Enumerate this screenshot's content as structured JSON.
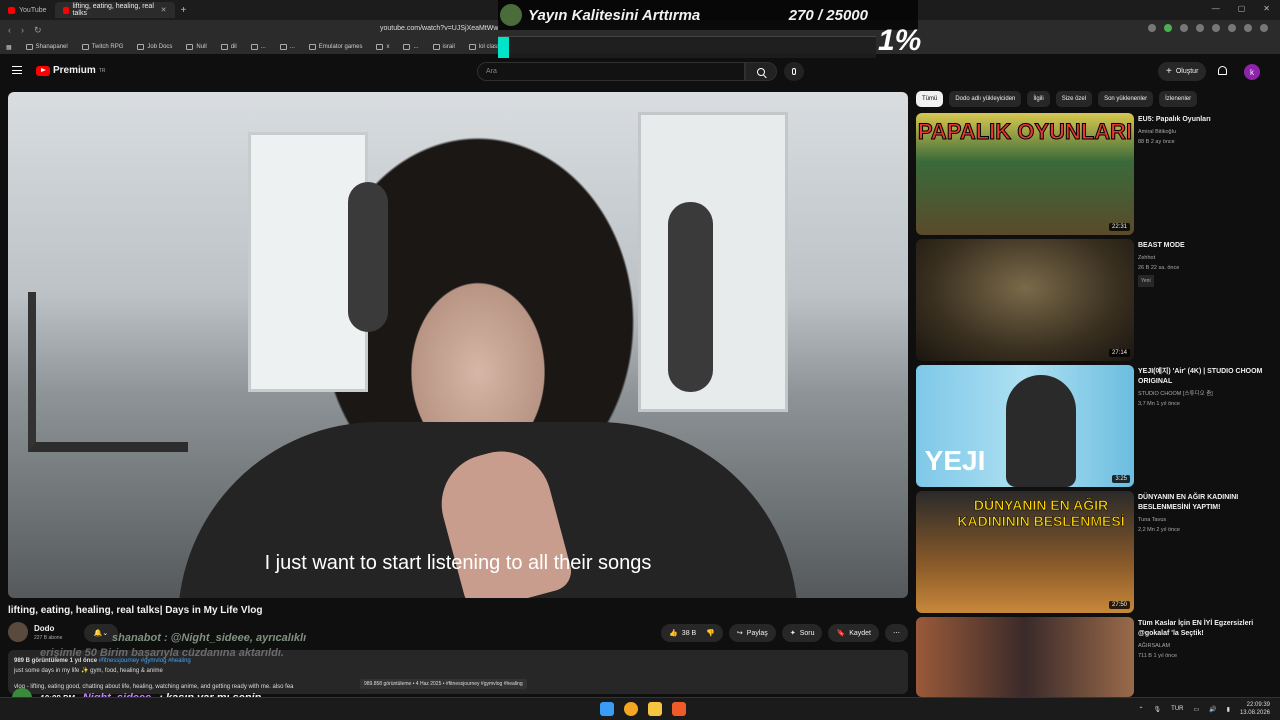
{
  "browser": {
    "tabs": [
      {
        "label": "YouTube"
      },
      {
        "label": "lifting, eating, healing, real talks"
      }
    ],
    "url": "youtube.com/watch?v=UJSjXeaMtWw",
    "bookmarks": [
      "Shanapanel",
      "Twitch RPG",
      "Job Docs",
      "Null",
      "dil",
      "...",
      "...",
      "Emulator games",
      "x",
      "...",
      "israil",
      "lol classic"
    ]
  },
  "stream_overlay": {
    "title": "Yayın Kalitesini Arttırma",
    "count": "270 / 25000",
    "percent": "1%",
    "progress": 0.0108
  },
  "header": {
    "logo_label": "Premium",
    "logo_badge": "TR",
    "search_placeholder": "Ara",
    "create_label": "Oluştur",
    "account_initial": "k"
  },
  "video": {
    "caption": "I just want to start listening to all their songs",
    "title": "lifting, eating, healing, real talks| Days in My Life Vlog",
    "channel": "Dodo",
    "subscribers": "227 B abone",
    "likes": "38 B",
    "share_label": "Paylaş",
    "ask_label": "Soru",
    "save_label": "Kaydet"
  },
  "description": {
    "meta": "989 B görüntüleme  1 yıl önce",
    "tags": "#fitnessjourney #gymvlog #healing",
    "line2": "just some days in my life ✨ gym, food, healing & anime",
    "line3": "vlog - lifting, eating good, chatting about life, healing, watching anime, and getting ready with me. also fea",
    "tooltip": "989.858 görüntüleme • 4 Haz 2025 • #fitnessjourney #gymvlog #healing"
  },
  "chat": {
    "line1": "shanabot : @Night_sideee, ayrıcalıklı",
    "line2": "erişimle 50 Birim başarıyla cüzdanına aktarıldı.",
    "time": "10:08 PM",
    "user": "Night_sideee",
    "message": ": kasın var mı senin"
  },
  "chips": [
    "Tümü",
    "Dodo adlı yükleyiciden",
    "İlgili",
    "Size özel",
    "Son yüklenenler",
    "İzlenenler"
  ],
  "recommendations": [
    {
      "title": "EU5: Papalık Oyunları",
      "channel": "Amiral Bitikoğlu",
      "meta": "88 B  2 ay önce",
      "duration": "22:31",
      "thumb_text": "PAPALIK OYUNLARI",
      "badge": ""
    },
    {
      "title": "BEAST MODE",
      "channel": "Zehhot",
      "meta": "26 B  22 sa. önce",
      "duration": "27:14",
      "thumb_text": "",
      "badge": "Yeni"
    },
    {
      "title": "YEJI(예지) 'Air' (4K) | STUDIO CHOOM ORIGINAL",
      "channel": "STUDIO CHOOM [스튜디오 춤]",
      "meta": "3,7 Mn  1 yıl önce",
      "duration": "3:25",
      "thumb_text": "YEJI",
      "badge": ""
    },
    {
      "title": "DÜNYANIN EN AĞIR KADININI BESLENMESİNİ YAPTIM!",
      "channel": "Tuna Tavus",
      "meta": "2,2 Mn  2 yıl önce",
      "duration": "27:50",
      "thumb_text": "DÜNYANIN EN AĞIR KADINININ BESLENMESİ",
      "badge": ""
    },
    {
      "title": "Tüm Kaslar İçin EN İYİ Egzersizleri @gokalaf 'la Seçtik!",
      "channel": "AĞIRSALAM",
      "meta": "711 B  1 yıl önce",
      "duration": "",
      "thumb_text": "",
      "badge": ""
    }
  ],
  "taskbar": {
    "lang": "TUR",
    "time": "22:09:39",
    "date": "13.08.2026"
  }
}
